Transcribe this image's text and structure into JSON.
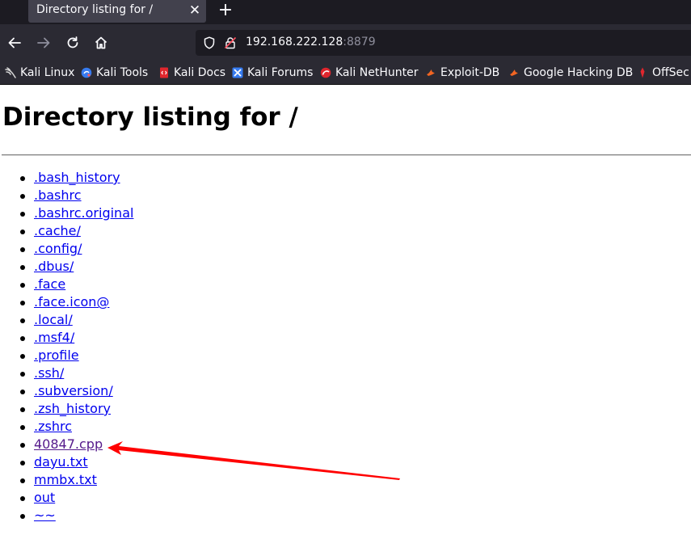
{
  "browser": {
    "tab": {
      "title": "Directory listing for /"
    },
    "url": {
      "host": "192.168.222.128",
      "port": ":8879"
    },
    "bookmarks": [
      {
        "label": "Kali Linux",
        "icon": "kali-dragon-icon"
      },
      {
        "label": "Kali Tools",
        "icon": "kali-tools-icon"
      },
      {
        "label": "Kali Docs",
        "icon": "kali-docs-icon"
      },
      {
        "label": "Kali Forums",
        "icon": "kali-forums-icon"
      },
      {
        "label": "Kali NetHunter",
        "icon": "nethunter-icon"
      },
      {
        "label": "Exploit-DB",
        "icon": "exploit-db-icon"
      },
      {
        "label": "Google Hacking DB",
        "icon": "ghdb-icon"
      },
      {
        "label": "OffSec",
        "icon": "offsec-icon"
      }
    ]
  },
  "page": {
    "heading": "Directory listing for /",
    "files": [
      ".bash_history",
      ".bashrc",
      ".bashrc.original",
      ".cache/",
      ".config/",
      ".dbus/",
      ".face",
      ".face.icon@",
      ".local/",
      ".msf4/",
      ".profile",
      ".ssh/",
      ".subversion/",
      ".zsh_history",
      ".zshrc",
      "40847.cpp",
      "dayu.txt",
      "mmbx.txt",
      "out",
      "~~"
    ],
    "visited_file": "40847.cpp"
  },
  "colors": {
    "link": "#0000ee",
    "visited_link": "#551a8b",
    "annotation_arrow": "#ff0000",
    "toolbar": "#2b2a33",
    "tabstrip": "#1c1b22"
  }
}
